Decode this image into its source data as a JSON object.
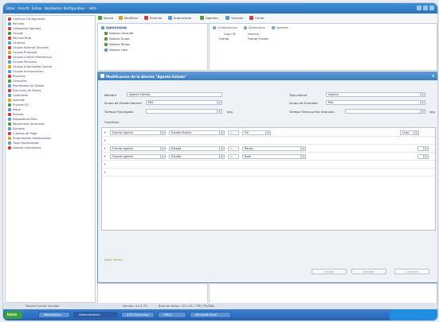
{
  "menu": [
    "Datei",
    "Ansicht",
    "Extras",
    "Bearbeiten",
    "Konfiguration",
    "Hilfe"
  ],
  "sidebar": {
    "items": [
      {
        "label": "Caminos Configurados",
        "color": "#d23c3c"
      },
      {
        "label": "Parches",
        "color": "#5c9ad6"
      },
      {
        "label": "Categorias Agentes",
        "color": "#d23c3c"
      },
      {
        "label": "Grupos",
        "color": "#4f9c38"
      },
      {
        "label": "Parches Ruta",
        "color": "#d23c3c"
      },
      {
        "label": "Usuarios",
        "color": "#5c9ad6"
      },
      {
        "label": "Grupos Alarmas Tecnicas",
        "color": "#d23c3c"
      },
      {
        "label": "Grupos Prioridad",
        "color": "#e0a020"
      },
      {
        "label": "Grupos Criterio Preferencia",
        "color": "#d23c3c"
      },
      {
        "label": "Grupos Personas",
        "color": "#5c9ad6"
      },
      {
        "label": "Grupos Autorizados Control",
        "color": "#e0a020"
      },
      {
        "label": "Grupos Incorporacion",
        "color": "#5c9ad6"
      },
      {
        "label": "Procesos",
        "color": "#d23c3c"
      },
      {
        "label": "Consultas",
        "color": "#4f9c38"
      },
      {
        "label": "Planificador de Tareas",
        "color": "#5c9ad6"
      },
      {
        "label": "Ejecucion de Tareas",
        "color": "#d23c3c"
      },
      {
        "label": "Calendario",
        "color": "#5c9ad6"
      },
      {
        "label": "Alarmas",
        "color": "#e0a020"
      },
      {
        "label": "Enlaces I/O",
        "color": "#4f9c38"
      },
      {
        "label": "Mapa",
        "color": "#5c9ad6"
      },
      {
        "label": "Puertos",
        "color": "#d23c3c"
      },
      {
        "label": "Dispositivos Paro",
        "color": "#5c9ad6"
      },
      {
        "label": "Parametros Generales",
        "color": "#4f9c38"
      },
      {
        "label": "Estudios",
        "color": "#5c9ad6"
      },
      {
        "label": "Cuentas de Pago",
        "color": "#d23c3c"
      },
      {
        "label": "Programador Instalaciones",
        "color": "#e0a020"
      },
      {
        "label": "Tipos Monitorados",
        "color": "#5c9ad6"
      },
      {
        "label": "Nuevos Indicadores",
        "color": "#d23c3c"
      }
    ]
  },
  "toolbar": {
    "nuevo": "Nuevo",
    "modificar": "Modificar",
    "eliminar": "Eliminar",
    "supervision": "Supervision",
    "agentes": "Agentes",
    "vincular": "Vincular",
    "cerrar": "Cerrar"
  },
  "tree": {
    "items": [
      {
        "label": "Agente Estado",
        "color": "#5c9ad6",
        "selected": true
      },
      {
        "label": "Nuevos Consulta",
        "color": "#4f9c38"
      },
      {
        "label": "Nuevos Grupo",
        "color": "#4f9c38"
      },
      {
        "label": "Nuevos Tareas",
        "color": "#4f9c38"
      },
      {
        "label": "Nuevos Listo",
        "color": "#5c9ad6"
      }
    ]
  },
  "right_panel": {
    "tools": [
      "Configuracion",
      "Supervision",
      "Agentes"
    ],
    "headers": [
      "Login ID",
      "Nombre"
    ],
    "row": [
      "Fuente",
      "Fuente Fuente"
    ]
  },
  "dialog": {
    "title": "Modificacion de la Alarma \"Agente Estado\"",
    "nombre_label": "Nombre",
    "nombre_value": "Agente Estado",
    "tipo_label": "Tipo alarma",
    "tipo_value": "Agente",
    "grupo_label": "Grupo de Estado Normal",
    "grupo_value": "Mid",
    "grupo_prioridad_label": "Grupo de Prioridad",
    "grupo_prioridad_value": "Mid",
    "tiempo_label": "Tiempo Prolongado",
    "tiempo_unit": "seg",
    "tiempo_tras_label": "Tiempo Transcurrido Intervalo",
    "tiempo_tras_unit": "seg",
    "condicion_label": "Condicion",
    "row1": {
      "a": "Fuente agente",
      "b": "Estado Motivo",
      "op": "=",
      "v": "Fin",
      "right": "Listo"
    },
    "row2": {
      "a": "Fuente agente",
      "b": "Estado",
      "op": "=",
      "v": "Pausa"
    },
    "row3": {
      "a": "Fuente agente",
      "b": "Estado",
      "op": "=",
      "v": "Bath"
    },
    "tabs": "Datos  Filtros",
    "buttons": [
      "Limpiar",
      "Aceptar",
      "Cancelar"
    ]
  },
  "status": {
    "left": "Tomate Fuente Servidor",
    "version": "Version: 4.0.4.73",
    "base": "Base de Datos: 127.0.0.1 TPR_PRUEBA"
  },
  "taskbar": {
    "start": "Inicio",
    "tasks": [
      "WorkStation",
      "Administracion",
      "ACD Supervisor",
      "Office",
      "Microsoft Excel"
    ]
  }
}
